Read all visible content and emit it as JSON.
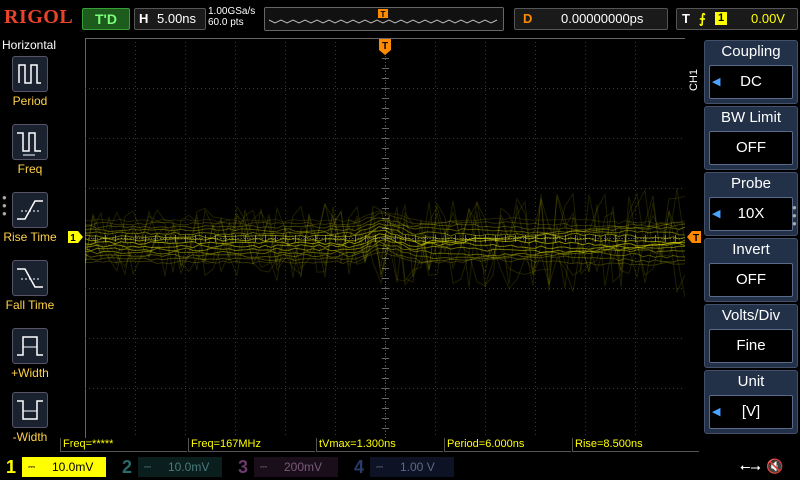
{
  "top": {
    "logo": "RIGOL",
    "run_status": "T'D",
    "hbase_label": "H",
    "hbase_value": "5.00ns",
    "sample_rate": "1.00GSa/s",
    "memory_depth": "60.0 pts",
    "delay_label": "D",
    "delay_value": "0.00000000ps",
    "trigger_label": "T",
    "trigger_edge": "⨍",
    "trigger_source": "1",
    "trigger_level": "0.00V"
  },
  "left_menu": {
    "title": "Horizontal",
    "items": [
      {
        "label": "Period",
        "icon": "period-icon"
      },
      {
        "label": "Freq",
        "icon": "freq-icon"
      },
      {
        "label": "Rise Time",
        "icon": "rise-time-icon"
      },
      {
        "label": "Fall Time",
        "icon": "fall-time-icon"
      },
      {
        "label": "+Width",
        "icon": "positive-width-icon"
      },
      {
        "label": "-Width",
        "icon": "negative-width-icon"
      }
    ]
  },
  "right_menu": {
    "channel_tab": "CH1",
    "items": [
      {
        "title": "Coupling",
        "value": "DC",
        "arrow": true
      },
      {
        "title": "BW Limit",
        "value": "OFF",
        "arrow": false
      },
      {
        "title": "Probe",
        "value": "10X",
        "arrow": true
      },
      {
        "title": "Invert",
        "value": "OFF",
        "arrow": false
      },
      {
        "title": "Volts/Div",
        "value": "Fine",
        "arrow": false
      },
      {
        "title": "Unit",
        "value": "[V]",
        "arrow": true
      }
    ]
  },
  "measurements": [
    "Freq=*****",
    "Freq=167MHz",
    "tVmax=1.300ns",
    "Period=6.000ns",
    "Rise=8.500ns"
  ],
  "markers": {
    "trigger_top": "T",
    "ch1_left": "1",
    "trig_level_right": "T"
  },
  "channels": [
    {
      "num": "1",
      "scale": "10.0mV",
      "color": "#ffff00",
      "active": true
    },
    {
      "num": "2",
      "scale": "10.0mV",
      "color": "#00c8c8",
      "active": false
    },
    {
      "num": "3",
      "scale": "200mV",
      "color": "#c050c0",
      "active": false
    },
    {
      "num": "4",
      "scale": "1.00 V",
      "color": "#3f6fdf",
      "active": false
    }
  ],
  "colors": {
    "ch1": "#ffff00",
    "trigger": "#ff8a00",
    "menu_bg": "#223048",
    "logo": "#e8442a"
  }
}
